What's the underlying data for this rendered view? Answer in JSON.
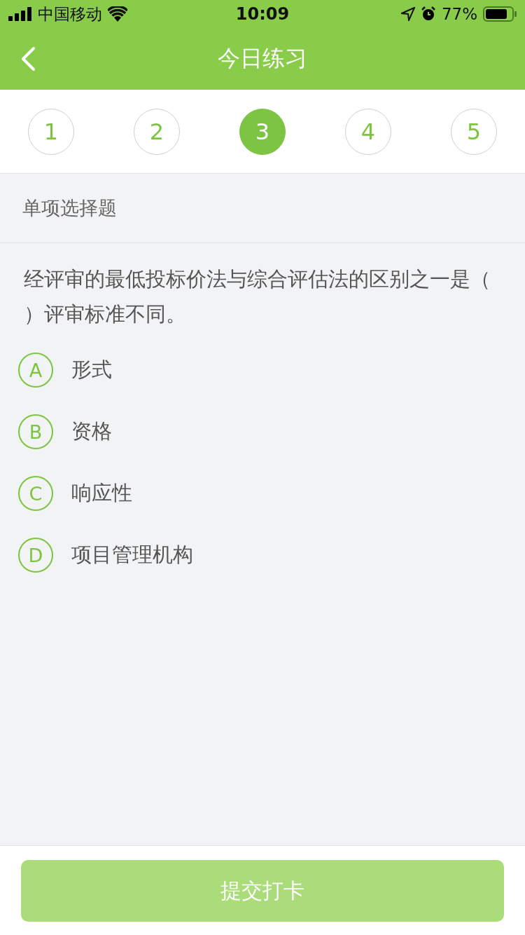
{
  "status_bar": {
    "carrier": "中国移动",
    "time": "10:09",
    "battery": "77%"
  },
  "nav": {
    "title": "今日练习"
  },
  "questions": [
    {
      "label": "1",
      "selected": false
    },
    {
      "label": "2",
      "selected": false
    },
    {
      "label": "3",
      "selected": true
    },
    {
      "label": "4",
      "selected": false
    },
    {
      "label": "5",
      "selected": false
    }
  ],
  "question_type": "单项选择题",
  "question_text": "经评审的最低投标价法与综合评估法的区别之一是（）评审标准不同。",
  "options": [
    {
      "letter": "A",
      "text": "形式",
      "selected": false
    },
    {
      "letter": "B",
      "text": "资格",
      "selected": false
    },
    {
      "letter": "C",
      "text": "响应性",
      "selected": false
    },
    {
      "letter": "D",
      "text": "项目管理机构",
      "selected": false
    }
  ],
  "submit": {
    "label": "提交打卡",
    "disabled": true
  }
}
